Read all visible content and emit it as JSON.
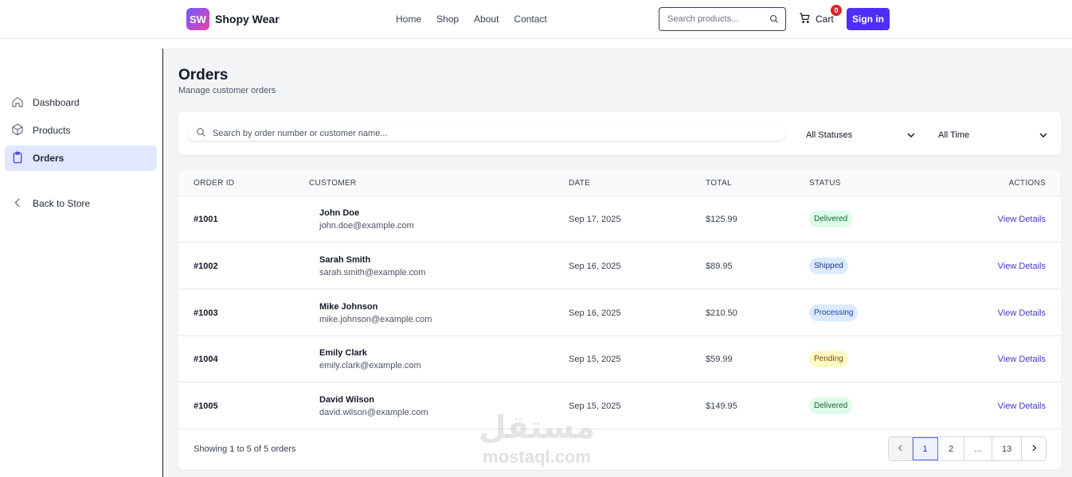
{
  "header": {
    "logo_text": "SW",
    "brand": "Shopy Wear",
    "nav": [
      "Home",
      "Shop",
      "About",
      "Contact"
    ],
    "search_placeholder": "Search products...",
    "cart_label": "Cart",
    "cart_count": "0",
    "signin_label": "Sign in"
  },
  "sidebar": {
    "items": [
      {
        "label": "Dashboard",
        "icon": "home-icon"
      },
      {
        "label": "Products",
        "icon": "box-icon"
      },
      {
        "label": "Orders",
        "icon": "clipboard-icon",
        "active": true
      },
      {
        "label": "Back to Store",
        "icon": "chevron-left-icon"
      }
    ]
  },
  "page": {
    "title": "Orders",
    "subtitle": "Manage customer orders"
  },
  "filters": {
    "search_placeholder": "Search by order number or customer name...",
    "status_value": "All Statuses",
    "time_value": "All Time"
  },
  "table": {
    "columns": [
      "ORDER ID",
      "CUSTOMER",
      "DATE",
      "TOTAL",
      "STATUS",
      "ACTIONS"
    ],
    "rows": [
      {
        "id": "#1001",
        "name": "John Doe",
        "email": "john.doe@example.com",
        "date": "Sep 17, 2025",
        "total": "$125.99",
        "status": "Delivered",
        "action": "View Details"
      },
      {
        "id": "#1002",
        "name": "Sarah Smith",
        "email": "sarah.smith@example.com",
        "date": "Sep 16, 2025",
        "total": "$89.95",
        "status": "Shipped",
        "action": "View Details"
      },
      {
        "id": "#1003",
        "name": "Mike Johnson",
        "email": "mike.johnson@example.com",
        "date": "Sep 16, 2025",
        "total": "$210.50",
        "status": "Processing",
        "action": "View Details"
      },
      {
        "id": "#1004",
        "name": "Emily Clark",
        "email": "emily.clark@example.com",
        "date": "Sep 15, 2025",
        "total": "$59.99",
        "status": "Pending",
        "action": "View Details"
      },
      {
        "id": "#1005",
        "name": "David Wilson",
        "email": "david.wilson@example.com",
        "date": "Sep 15, 2025",
        "total": "$149.95",
        "status": "Delivered",
        "action": "View Details"
      }
    ],
    "showing": "Showing 1 to 5 of 5 orders"
  },
  "pagination": {
    "pages": [
      "1",
      "2",
      "...",
      "13"
    ],
    "current": "1"
  },
  "watermark": {
    "arabic": "مستقل",
    "latin": "mostaql.com"
  },
  "colors": {
    "accent": "#4f2ef7",
    "active_nav_bg": "#e0e7ff",
    "link": "#4338ca"
  }
}
